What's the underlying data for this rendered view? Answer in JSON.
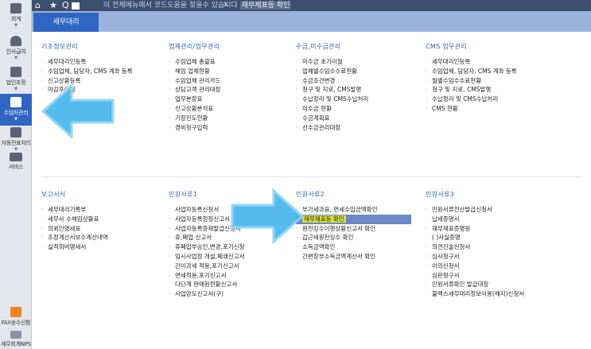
{
  "topbar": {
    "tab_text": "이 전체메뉴에서 코드도움을 찾을수 있습니다",
    "tab_active": "재무제표등 확인",
    "icons": [
      "home-icon",
      "star-icon",
      "search-icon",
      "window-icon",
      "close-icon"
    ]
  },
  "tabstrip": {
    "active_tab": "세무대리"
  },
  "sidebar": {
    "items": [
      {
        "label": "회계",
        "icon": "calculator-icon"
      },
      {
        "label": "인사급여",
        "icon": "person-icon"
      },
      {
        "label": "법인조정",
        "icon": "building-icon"
      },
      {
        "label": "수임처관리",
        "icon": "client-card-icon",
        "active": true
      },
      {
        "label": "자동전표처리",
        "icon": "auto-voucher-icon"
      },
      {
        "label": "서비스",
        "icon": "monitor-icon"
      },
      {
        "label": "FAX송수신함",
        "icon": "fax-icon"
      },
      {
        "label": "세무회계NPS",
        "icon": "chart-icon"
      }
    ]
  },
  "sections": [
    {
      "title": "기초정보관리",
      "items": [
        "세무대리인등록",
        "수임업체, 담당자, CMS 계좌 등록",
        "신고상황등록",
        "마감후이월"
      ]
    },
    {
      "title": "업체관리/업무관리",
      "items": [
        "수임업체 총괄표",
        "해임 업체현황",
        "수임업체 관리카드",
        "상담고객 관리대장",
        "업무분장표",
        "신고상황분석표",
        "기장진도현황",
        "경비청구입력"
      ]
    },
    {
      "title": "수금,미수금관리",
      "items": [
        "미수금 초기이월",
        "업체별수임수수료현황",
        "수금조건변경",
        "청구 및 지로, CMS발행",
        "수납정리 및 CMS수납처리",
        "미수금 현황",
        "수금계획표",
        "선수금관리대장"
      ]
    },
    {
      "title": "CMS 업무관리",
      "items": [
        "세무대리인등록",
        "수임업체, 담당자, CMS 계좌 등록",
        "월별수임수수료현황",
        "청구 및 지로, CMS발행",
        "수납정리 및 CMS수납처리",
        "CMS 현황"
      ]
    },
    {
      "title": "보고서식",
      "items": [
        "세무대리기록부",
        "세무사 수해임상황표",
        "의뢰인명세표",
        "조정계산서보수계산내역",
        "실적회비명세서"
      ]
    },
    {
      "title": "민원서류1",
      "items": [
        "사업자등록신청서",
        "사업자등록정정신고서",
        "사업자등록증재발급신청서",
        "휴,폐업 신고서",
        "휴폐업부승인,변경,포기신청",
        "임시사업장 개설,폐쇄신고서",
        "간이과세 적용,포기신고서",
        "면세적용,포기신고서",
        "다단계 판매원현황신고서",
        "사업양도신고서(구)"
      ]
    },
    {
      "title": "민원서류2",
      "items": [
        "부가세과표, 면세수입금액확인",
        "재무제표등 확인",
        "원천징수이행상황신고서 확인",
        "갑근세원천징수 확인",
        "소득금액확인",
        "간편장부소득금액계산서 확인"
      ],
      "highlight_index": 1
    },
    {
      "title": "민원서류3",
      "items": [
        "민원서류전산발급신청서",
        "납세증명서",
        "재무제표증명원",
        "(   )사실증명",
        "의견진술신청서",
        "심사청구서",
        "이의신청서",
        "심판청구서",
        "민원서류확인 발급대장",
        "불백스세무대리정보이용(해지)신청서"
      ]
    }
  ]
}
